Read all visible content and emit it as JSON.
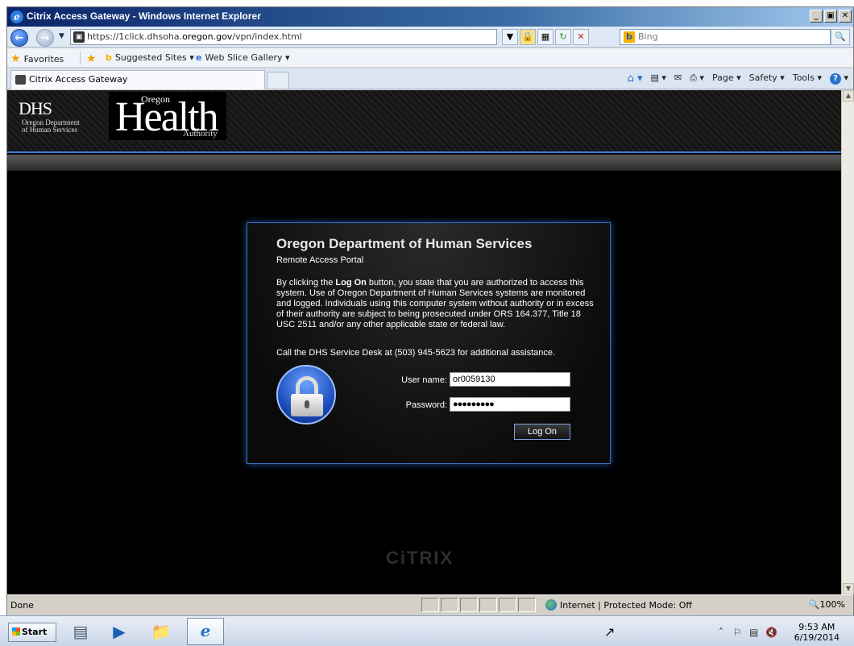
{
  "window": {
    "title": "Citrix Access Gateway - Windows Internet Explorer",
    "buttons": {
      "minimize": "_",
      "maximize": "▣",
      "close": "✕"
    }
  },
  "addressbar": {
    "url_prefix": "https://1click.dhsoha.",
    "url_domain": "oregon.gov",
    "url_path": "/vpn/index.html",
    "search_placeholder": "Bing"
  },
  "favorites": {
    "label": "Favorites",
    "items": [
      "Suggested Sites ▾",
      "Web Slice Gallery ▾"
    ]
  },
  "tabs": [
    {
      "label": "Citrix Access Gateway"
    }
  ],
  "commandbar": {
    "page": "Page ▾",
    "safety": "Safety ▾",
    "tools": "Tools ▾",
    "help": "?"
  },
  "banner": {
    "dhs_logo": "DHS",
    "dhs_sub": "Oregon Department of Human Services",
    "oha_top": "Oregon",
    "oha_main": "Health",
    "oha_bottom": "Authority"
  },
  "login": {
    "heading": "Oregon Department of Human Services",
    "subtitle": "Remote Access Portal",
    "notice_pre": "By clicking the ",
    "notice_bold": "Log On",
    "notice_post": " button, you state that you are authorized to access this system. Use of Oregon Department of Human Services systems are monitored and logged. Individuals using this computer system without authority or in excess of their authority are subject to being prosecuted under ORS 164.377, Title 18 USC 2511 and/or any other applicable state or federal law.",
    "help_text": "Call the DHS Service Desk at (503) 945-5623 for additional assistance.",
    "username_label": "User name:",
    "username_value": "or0059130",
    "password_label": "Password:",
    "password_value": "●●●●●●●●●",
    "logon_button": "Log On"
  },
  "footer_logo": "CiTRIX",
  "statusbar": {
    "status": "Done",
    "zone": "Internet | Protected Mode: Off",
    "zoom": "🔍100%"
  },
  "taskbar": {
    "start": "Start",
    "time": "9:53 AM",
    "date": "6/19/2014"
  },
  "colors": {
    "accent": "#3b6fc4",
    "titlebar": "#0a246a"
  }
}
